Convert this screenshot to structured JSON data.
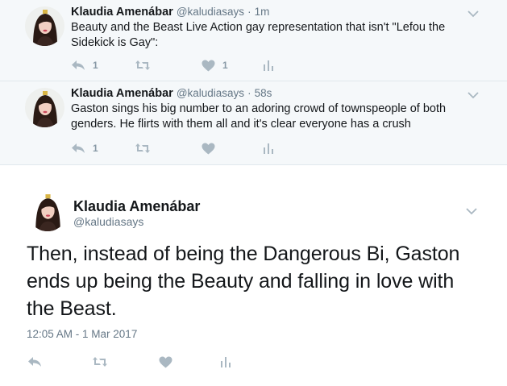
{
  "thread": [
    {
      "name": "Klaudia Amenábar",
      "handle": "@kaludiasays",
      "separator": "·",
      "time": "1m",
      "text": "Beauty and the Beast Live Action gay representation that isn't \"Lefou the Sidekick is Gay\":",
      "reply_count": "1",
      "retweet_count": "",
      "like_count": "1"
    },
    {
      "name": "Klaudia Amenábar",
      "handle": "@kaludiasays",
      "separator": "·",
      "time": "58s",
      "text": "Gaston sings his big number to an adoring crowd of townspeople of both genders. He flirts with them all and it's clear everyone has a crush",
      "reply_count": "1",
      "retweet_count": "",
      "like_count": ""
    }
  ],
  "main": {
    "name": "Klaudia Amenábar",
    "handle": "@kaludiasays",
    "text": "Then, instead of being the Dangerous Bi, Gaston ends up being the Beauty and falling in love with the Beast.",
    "date": "12:05 AM - 1 Mar 2017"
  },
  "icons": {
    "reply": "reply-icon",
    "retweet": "retweet-icon",
    "like": "heart-icon",
    "analytics": "analytics-icon",
    "caret": "chevron-down-icon"
  },
  "colors": {
    "icon_gray": "#aab8c2",
    "count_gray": "#8899a6",
    "thread_bg": "#f5f8fa",
    "divider": "#e1e8ed",
    "text": "#14171a",
    "secondary": "#657786"
  }
}
